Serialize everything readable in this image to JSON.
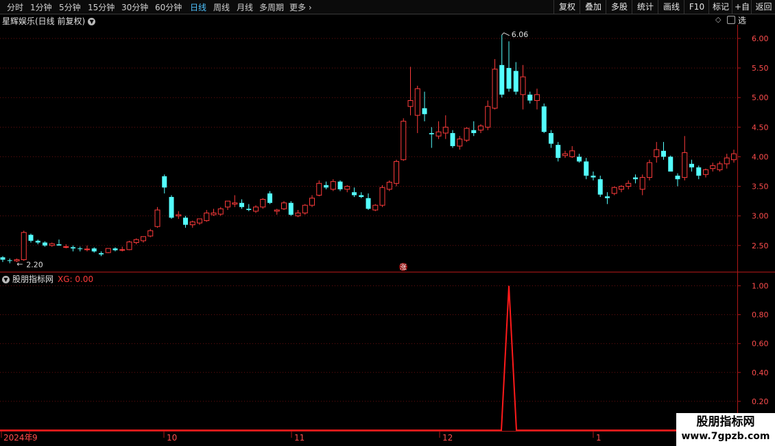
{
  "toolbar": {
    "periods": [
      "分时",
      "1分钟",
      "5分钟",
      "15分钟",
      "30分钟",
      "60分钟",
      "日线",
      "周线",
      "月线",
      "多周期",
      "更多"
    ],
    "active_period": "日线",
    "actions": [
      "复权",
      "叠加",
      "多股",
      "统计",
      "画线",
      "F10",
      "标记",
      "+自选",
      "返回"
    ]
  },
  "main_title": "星辉娱乐(日线 前复权)",
  "annotations": {
    "high_label": "6.06",
    "low_label": "2.20",
    "marker": "涨"
  },
  "indicator": {
    "name": "股朋指标网",
    "value_label": "XG: 0.00"
  },
  "watermark": {
    "line1": "股朋指标网",
    "line2": "www.7gpzb.com"
  },
  "colors": {
    "up": "#ff3b3b",
    "down": "#54ffff",
    "axis": "#b01818",
    "bg": "#000000"
  },
  "chart_data": [
    {
      "type": "candlestick",
      "y_axis_ticks": [
        "6.00",
        "5.50",
        "5.00",
        "4.50",
        "4.00",
        "3.50",
        "3.00",
        "2.50"
      ],
      "ylim": [
        2.08,
        6.22
      ],
      "x_tick_labels": [
        "2024年",
        "9",
        "10",
        "11",
        "12",
        "1"
      ],
      "high": 6.06,
      "low": 2.2,
      "ohlc": [
        [
          2.3,
          2.32,
          2.22,
          2.26
        ],
        [
          2.25,
          2.28,
          2.2,
          2.24
        ],
        [
          2.24,
          2.28,
          2.22,
          2.26
        ],
        [
          2.26,
          2.75,
          2.24,
          2.72
        ],
        [
          2.68,
          2.7,
          2.55,
          2.58
        ],
        [
          2.58,
          2.6,
          2.52,
          2.55
        ],
        [
          2.55,
          2.57,
          2.48,
          2.5
        ],
        [
          2.5,
          2.55,
          2.48,
          2.53
        ],
        [
          2.52,
          2.6,
          2.5,
          2.5
        ],
        [
          2.48,
          2.52,
          2.45,
          2.48
        ],
        [
          2.47,
          2.5,
          2.4,
          2.45
        ],
        [
          2.45,
          2.48,
          2.4,
          2.44
        ],
        [
          2.44,
          2.5,
          2.4,
          2.44
        ],
        [
          2.45,
          2.47,
          2.38,
          2.4
        ],
        [
          2.37,
          2.4,
          2.32,
          2.35
        ],
        [
          2.38,
          2.45,
          2.37,
          2.45
        ],
        [
          2.45,
          2.47,
          2.4,
          2.42
        ],
        [
          2.42,
          2.48,
          2.4,
          2.43
        ],
        [
          2.43,
          2.58,
          2.42,
          2.56
        ],
        [
          2.55,
          2.62,
          2.52,
          2.6
        ],
        [
          2.58,
          2.65,
          2.55,
          2.65
        ],
        [
          2.66,
          2.78,
          2.64,
          2.75
        ],
        [
          2.82,
          3.15,
          2.8,
          3.1
        ],
        [
          3.67,
          3.7,
          3.38,
          3.48
        ],
        [
          3.32,
          3.35,
          2.95,
          2.97
        ],
        [
          3.0,
          3.08,
          2.95,
          3.02
        ],
        [
          2.97,
          3.0,
          2.8,
          2.85
        ],
        [
          2.85,
          2.92,
          2.8,
          2.9
        ],
        [
          2.88,
          2.95,
          2.85,
          2.95
        ],
        [
          2.92,
          3.1,
          2.9,
          3.05
        ],
        [
          3.02,
          3.12,
          3.0,
          3.05
        ],
        [
          3.03,
          3.15,
          3.0,
          3.12
        ],
        [
          3.15,
          3.25,
          3.1,
          3.25
        ],
        [
          3.2,
          3.35,
          3.15,
          3.22
        ],
        [
          3.22,
          3.28,
          3.12,
          3.15
        ],
        [
          3.12,
          3.2,
          3.08,
          3.1
        ],
        [
          3.08,
          3.18,
          3.05,
          3.15
        ],
        [
          3.15,
          3.3,
          3.12,
          3.28
        ],
        [
          3.38,
          3.42,
          3.2,
          3.22
        ],
        [
          3.08,
          3.12,
          3.02,
          3.1
        ],
        [
          3.12,
          3.25,
          3.1,
          3.22
        ],
        [
          3.22,
          3.25,
          3.0,
          3.02
        ],
        [
          3.0,
          3.1,
          2.98,
          3.05
        ],
        [
          3.05,
          3.2,
          3.02,
          3.18
        ],
        [
          3.18,
          3.35,
          3.15,
          3.3
        ],
        [
          3.35,
          3.6,
          3.33,
          3.55
        ],
        [
          3.52,
          3.58,
          3.45,
          3.48
        ],
        [
          3.45,
          3.62,
          3.42,
          3.58
        ],
        [
          3.58,
          3.6,
          3.42,
          3.45
        ],
        [
          3.45,
          3.52,
          3.4,
          3.5
        ],
        [
          3.4,
          3.48,
          3.32,
          3.35
        ],
        [
          3.35,
          3.4,
          3.3,
          3.32
        ],
        [
          3.3,
          3.38,
          3.1,
          3.12
        ],
        [
          3.1,
          3.2,
          3.08,
          3.18
        ],
        [
          3.18,
          3.52,
          3.15,
          3.48
        ],
        [
          3.45,
          3.6,
          3.42,
          3.57
        ],
        [
          3.55,
          3.95,
          3.5,
          3.92
        ],
        [
          3.95,
          4.65,
          3.93,
          4.6
        ],
        [
          4.85,
          5.52,
          4.7,
          4.95
        ],
        [
          4.7,
          5.2,
          4.4,
          5.15
        ],
        [
          4.82,
          5.1,
          4.6,
          4.72
        ],
        [
          4.4,
          4.5,
          4.15,
          4.38
        ],
        [
          4.35,
          4.6,
          4.3,
          4.42
        ],
        [
          4.4,
          4.7,
          4.3,
          4.5
        ],
        [
          4.4,
          4.45,
          4.15,
          4.18
        ],
        [
          4.18,
          4.35,
          4.12,
          4.3
        ],
        [
          4.28,
          4.5,
          4.25,
          4.48
        ],
        [
          4.45,
          4.6,
          4.35,
          4.4
        ],
        [
          4.45,
          4.55,
          4.4,
          4.52
        ],
        [
          4.5,
          4.95,
          4.45,
          4.85
        ],
        [
          4.82,
          5.65,
          4.8,
          5.48
        ],
        [
          5.55,
          6.06,
          5.0,
          5.05
        ],
        [
          5.5,
          5.95,
          5.1,
          5.15
        ],
        [
          5.45,
          5.6,
          5.05,
          5.1
        ],
        [
          5.05,
          5.55,
          4.8,
          5.35
        ],
        [
          5.05,
          5.1,
          4.9,
          4.95
        ],
        [
          4.95,
          5.15,
          4.8,
          5.05
        ],
        [
          4.85,
          4.9,
          4.4,
          4.42
        ],
        [
          4.4,
          4.45,
          4.15,
          4.22
        ],
        [
          4.2,
          4.25,
          3.92,
          3.98
        ],
        [
          4.02,
          4.1,
          3.98,
          4.05
        ],
        [
          4.0,
          4.18,
          3.98,
          4.1
        ],
        [
          4.0,
          4.05,
          3.9,
          3.92
        ],
        [
          3.92,
          3.98,
          3.62,
          3.68
        ],
        [
          3.68,
          3.75,
          3.6,
          3.65
        ],
        [
          3.62,
          3.68,
          3.32,
          3.36
        ],
        [
          3.33,
          3.4,
          3.2,
          3.3
        ],
        [
          3.38,
          3.5,
          3.35,
          3.48
        ],
        [
          3.45,
          3.52,
          3.4,
          3.5
        ],
        [
          3.5,
          3.6,
          3.45,
          3.55
        ],
        [
          3.65,
          3.7,
          3.55,
          3.62
        ],
        [
          3.45,
          3.7,
          3.35,
          3.65
        ],
        [
          3.65,
          3.95,
          3.6,
          3.9
        ],
        [
          4.0,
          4.25,
          3.9,
          4.12
        ],
        [
          4.1,
          4.25,
          3.95,
          4.0
        ],
        [
          4.0,
          4.02,
          3.75,
          3.75
        ],
        [
          3.68,
          3.72,
          3.5,
          3.62
        ],
        [
          3.65,
          4.35,
          3.6,
          4.07
        ],
        [
          3.88,
          3.95,
          3.75,
          3.82
        ],
        [
          3.82,
          3.85,
          3.62,
          3.68
        ],
        [
          3.7,
          3.8,
          3.65,
          3.78
        ],
        [
          3.8,
          3.9,
          3.75,
          3.85
        ],
        [
          3.78,
          3.92,
          3.75,
          3.88
        ],
        [
          3.88,
          4.05,
          3.8,
          3.98
        ],
        [
          3.95,
          4.12,
          3.9,
          4.05
        ]
      ]
    },
    {
      "type": "line",
      "name": "XG",
      "y_axis_ticks": [
        "1.00",
        "0.80",
        "0.60",
        "0.40",
        "0.20"
      ],
      "ylim": [
        0,
        1.05
      ],
      "spike_index": 72,
      "spike_value": 1.0
    }
  ]
}
